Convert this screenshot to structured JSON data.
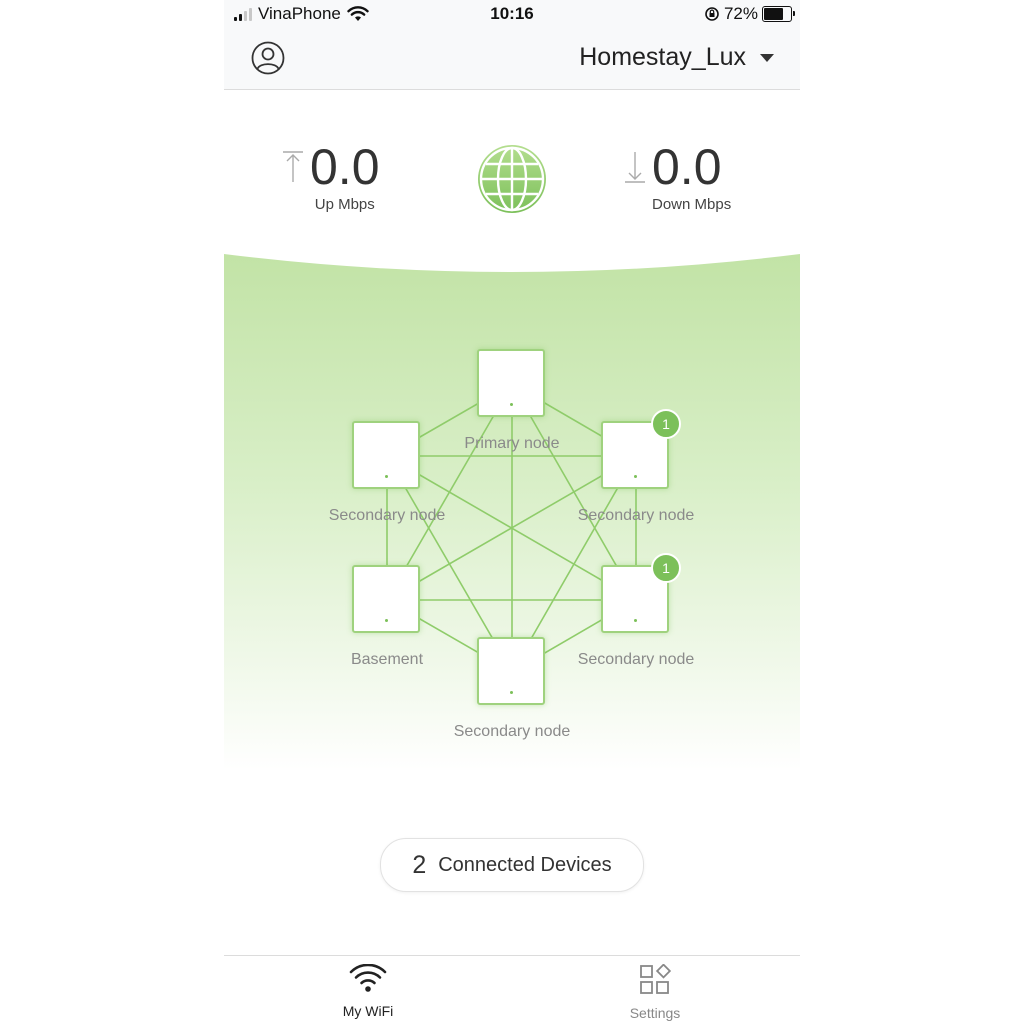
{
  "status_bar": {
    "carrier": "VinaPhone",
    "time": "10:16",
    "battery_percent": "72%",
    "battery_level": 0.72,
    "signal_bars": 2
  },
  "header": {
    "network_name": "Homestay_Lux",
    "icons": {
      "profile": "user-icon",
      "dropdown": "caret-down-icon"
    }
  },
  "speed": {
    "up_value": "0.0",
    "up_label": "Up Mbps",
    "down_value": "0.0",
    "down_label": "Down Mbps",
    "icons": {
      "up": "upload-arrow-icon",
      "center": "globe-icon",
      "down": "download-arrow-icon"
    }
  },
  "mesh": {
    "nodes": [
      {
        "id": "primary",
        "label": "Primary node",
        "badge": ""
      },
      {
        "id": "left-upper",
        "label": "Secondary node",
        "badge": ""
      },
      {
        "id": "right-upper",
        "label": "Secondary node",
        "badge": "1"
      },
      {
        "id": "left-lower",
        "label": "Basement",
        "badge": ""
      },
      {
        "id": "right-lower",
        "label": "Secondary node",
        "badge": "1"
      },
      {
        "id": "bottom",
        "label": "Secondary node",
        "badge": ""
      }
    ]
  },
  "devices": {
    "count": "2",
    "label": "Connected Devices"
  },
  "tabs": [
    {
      "label": "My WiFi",
      "icon": "wifi-icon",
      "active": true
    },
    {
      "label": "Settings",
      "icon": "settings-grid-icon",
      "active": false
    }
  ],
  "colors": {
    "accent_green": "#7cc05a",
    "node_border": "#9fd27e",
    "text_dark": "#333333",
    "text_muted": "#8a8a8a",
    "header_bg": "#f8f9fa"
  }
}
